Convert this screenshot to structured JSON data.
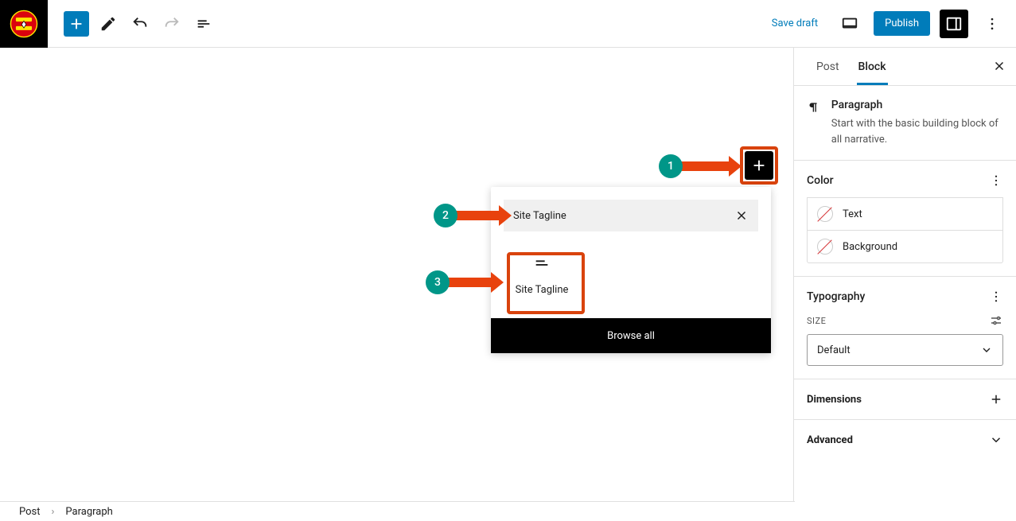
{
  "topbar": {
    "save_draft": "Save draft",
    "publish": "Publish"
  },
  "sidebar": {
    "tabs": {
      "post": "Post",
      "block": "Block"
    },
    "block": {
      "title": "Paragraph",
      "description": "Start with the basic building block of all narrative."
    },
    "color": {
      "heading": "Color",
      "text": "Text",
      "background": "Background"
    },
    "typography": {
      "heading": "Typography",
      "size_label": "SIZE",
      "size_value": "Default"
    },
    "dimensions": {
      "heading": "Dimensions"
    },
    "advanced": {
      "heading": "Advanced"
    }
  },
  "inserter": {
    "search_value": "Site Tagline",
    "result_label": "Site Tagline",
    "browse_all": "Browse all"
  },
  "annotations": {
    "1": "1",
    "2": "2",
    "3": "3"
  },
  "footer": {
    "post": "Post",
    "paragraph": "Paragraph"
  }
}
